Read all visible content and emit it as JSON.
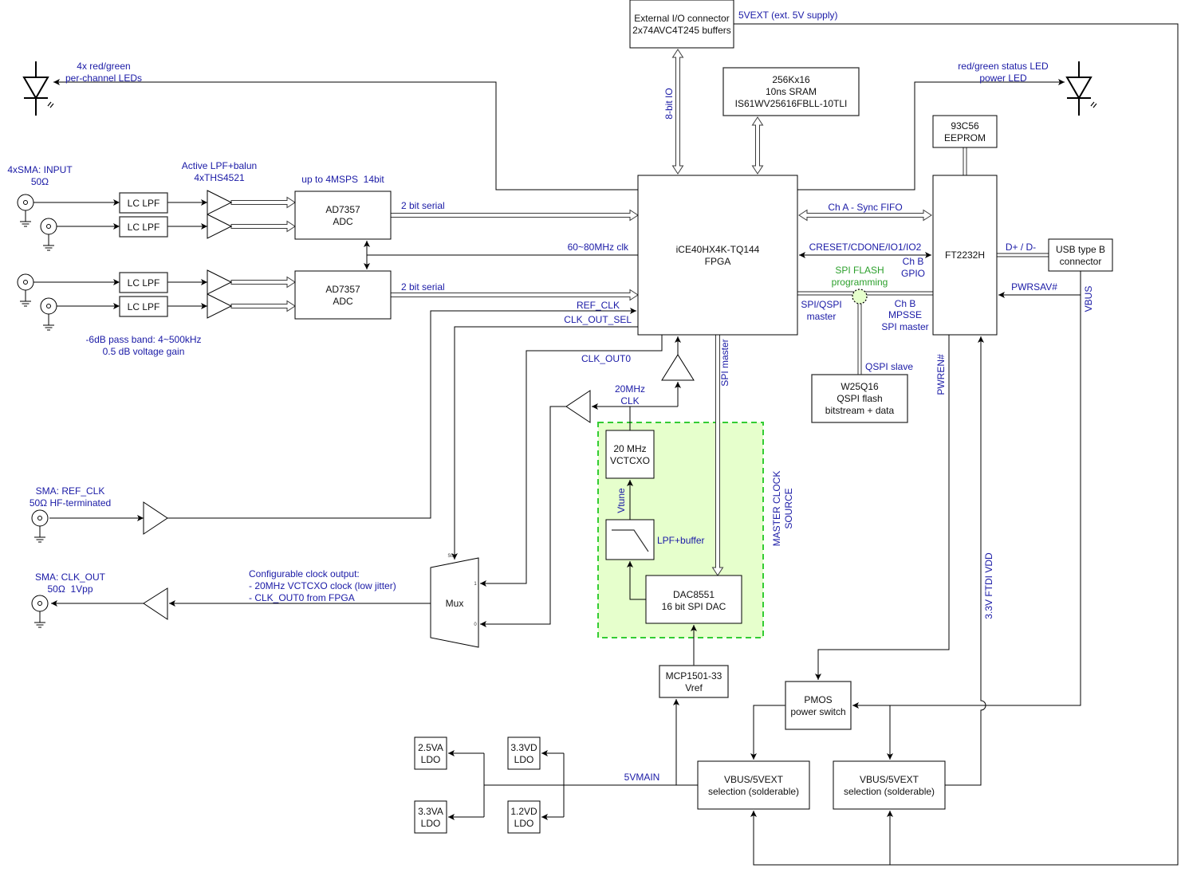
{
  "blocks": {
    "ext_io": [
      "External I/O connector",
      "2x74AVC4T245 buffers"
    ],
    "sram": [
      "256Kx16",
      "10ns SRAM",
      "IS61WV25616FBLL-10TLI"
    ],
    "eeprom": [
      "93C56",
      "EEPROM"
    ],
    "fpga": [
      "iCE40HX4K-TQ144",
      "FPGA"
    ],
    "ft2232h": [
      "FT2232H"
    ],
    "usb": [
      "USB type B",
      "connector"
    ],
    "lc_lpf": [
      "LC LPF",
      "LC LPF",
      "LC LPF",
      "LC LPF"
    ],
    "adc": [
      [
        "AD7357",
        "ADC"
      ],
      [
        "AD7357",
        "ADC"
      ]
    ],
    "flash": [
      "W25Q16",
      "QSPI flash",
      "bitstream + data"
    ],
    "vctcxo": [
      "20 MHz",
      "VCTCXO"
    ],
    "dac": [
      "DAC8551",
      "16 bit SPI DAC"
    ],
    "mcp": [
      "MCP1501-33",
      "Vref"
    ],
    "pmos": [
      "PMOS",
      "power switch"
    ],
    "vsel": [
      [
        "VBUS/5VEXT",
        "selection (solderable)"
      ],
      [
        "VBUS/5VEXT",
        "selection (solderable)"
      ]
    ],
    "ldo": {
      "a25": [
        "2.5VA",
        "LDO"
      ],
      "a33": [
        "3.3VA",
        "LDO"
      ],
      "d33": [
        "3.3VD",
        "LDO"
      ],
      "d12": [
        "1.2VD",
        "LDO"
      ]
    },
    "mux": {
      "label": "Mux",
      "sel_pin": "S0",
      "in1_pin": "1",
      "in0_pin": "0"
    }
  },
  "labels": {
    "ext_supply": "5VEXT (ext. 5V supply)",
    "channel_leds": [
      "4x red/green",
      "per-channel LEDs"
    ],
    "status_leds": [
      "red/green status LED",
      "power LED"
    ],
    "io_bus": "8-bit IO",
    "sma_input": [
      "4xSMA: INPUT",
      "50Ω"
    ],
    "active_lpf": [
      "Active LPF+balun",
      "4xTHS4521"
    ],
    "adc_spec": "up to 4MSPS  14bit",
    "serial": [
      "2 bit serial",
      "2 bit serial"
    ],
    "adc_clk": "60~80MHz clk",
    "ref_clk": "REF_CLK",
    "clk_out_sel": "CLK_OUT_SEL",
    "clk_out0": "CLK_OUT0",
    "passband": [
      "-6dB pass band: 4~500kHz",
      "0.5 dB voltage gain"
    ],
    "ch_a": "Ch A - Sync FIFO",
    "creset": "CRESET/CDONE/IO1/IO2",
    "ch_b_gpio": [
      "Ch B",
      "GPIO"
    ],
    "spi_flash_prog": [
      "SPI FLASH",
      "programming"
    ],
    "spi_qspi_master": [
      "SPI/QSPI",
      "master"
    ],
    "ch_b_mpsse": [
      "Ch B",
      "MPSSE",
      "SPI master"
    ],
    "usb_data": "D+ / D-",
    "pwrsav": "PWRSAV#",
    "vbus": "VBUS",
    "clk20": [
      "20MHz",
      "CLK"
    ],
    "spi_master": "SPI master",
    "qspi_slave": "QSPI slave",
    "pwren": "PWREN#",
    "ftdi_vdd": "3.3V FTDI VDD",
    "vtune": "Vtune",
    "lpf_buffer": "LPF+buffer",
    "master_clock": [
      "MASTER CLOCK",
      "SOURCE"
    ],
    "sma_ref_clk": [
      "SMA: REF_CLK",
      "50Ω HF-terminated"
    ],
    "sma_clk_out": [
      "SMA: CLK_OUT",
      "50Ω  1Vpp"
    ],
    "clk_out_desc": [
      "Configurable clock output:",
      "- 20MHz VCTCXO clock (low jitter)",
      "- CLK_OUT0 from FPGA"
    ],
    "main_rail": "5VMAIN"
  },
  "colors": {
    "label": "#1a1aa6",
    "highlight": "#2ca02c",
    "clock_region_fill": "#e6ffcc",
    "clock_region_border": "#33cc33"
  }
}
